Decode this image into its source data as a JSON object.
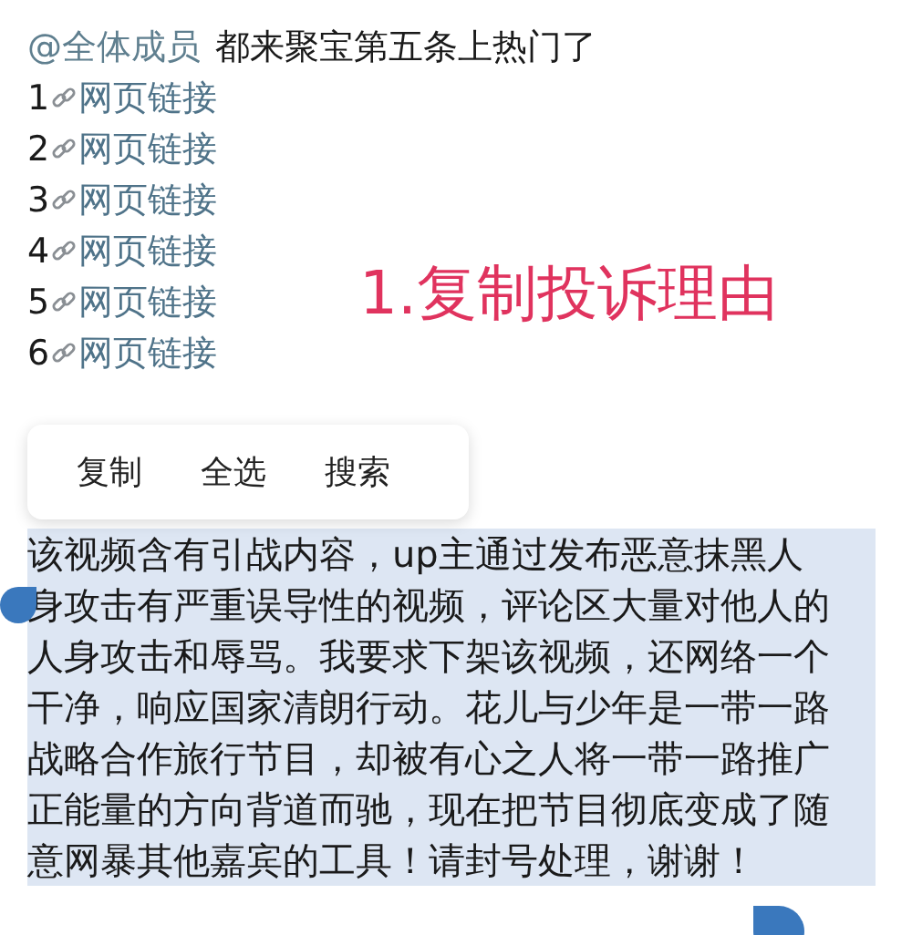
{
  "message": {
    "mention": "@全体成员",
    "text": "都来聚宝第五条上热门了",
    "links": [
      {
        "number": "1",
        "label": "网页链接"
      },
      {
        "number": "2",
        "label": "网页链接"
      },
      {
        "number": "3",
        "label": "网页链接"
      },
      {
        "number": "4",
        "label": "网页链接"
      },
      {
        "number": "5",
        "label": "网页链接"
      },
      {
        "number": "6",
        "label": "网页链接"
      }
    ]
  },
  "annotation": "1.复制投诉理由",
  "context_menu": {
    "items": [
      "复制",
      "全选",
      "搜索"
    ]
  },
  "selected_text": "该视频含有引战内容，up主通过发布恶意抹黑人身攻击有严重误导性的视频，评论区大量对他人的人身攻击和辱骂。我要求下架该视频，还网络一个干净，响应国家清朗行动。花儿与少年是一带一路战略合作旅行节目，却被有心之人将一带一路推广正能量的方向背道而驰，现在把节目彻底变成了随意网暴其他嘉宾的工具！请封号处理，谢谢！"
}
